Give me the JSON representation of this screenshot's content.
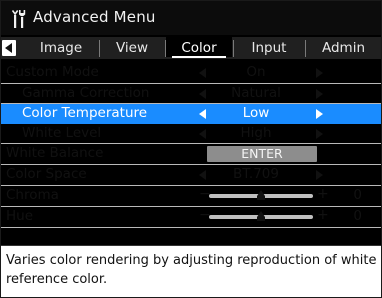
{
  "window": {
    "title": "Advanced Menu",
    "title_icon": "tools-icon"
  },
  "tabs": [
    {
      "label": "Image",
      "active": false
    },
    {
      "label": "View",
      "active": false
    },
    {
      "label": "Color",
      "active": true
    },
    {
      "label": "Input",
      "active": false
    },
    {
      "label": "Admin",
      "active": false
    }
  ],
  "menu": {
    "custom_mode": {
      "label": "Custom Mode",
      "value": "On"
    },
    "gamma_correction": {
      "label": "Gamma Correction",
      "value": "Natural"
    },
    "color_temperature": {
      "label": "Color Temperature",
      "value": "Low"
    },
    "white_level": {
      "label": "White Level",
      "value": "High"
    },
    "white_balance": {
      "label": "White Balance",
      "button": "ENTER"
    },
    "color_space": {
      "label": "Color Space",
      "value": "BT.709"
    },
    "chroma": {
      "label": "Chroma",
      "value": "0",
      "minus": "−",
      "plus": "+",
      "level_fraction": 0.5
    },
    "hue": {
      "label": "Hue",
      "value": "0",
      "minus": "−",
      "plus": "+",
      "level_fraction": 0.5
    }
  },
  "description": "Varies color rendering by adjusting reproduction of white reference color.",
  "colors": {
    "selection": "#1a8cff",
    "titlebar": "#0c0c0c",
    "tabbar": "#202020",
    "button": "#8d8d8d"
  }
}
